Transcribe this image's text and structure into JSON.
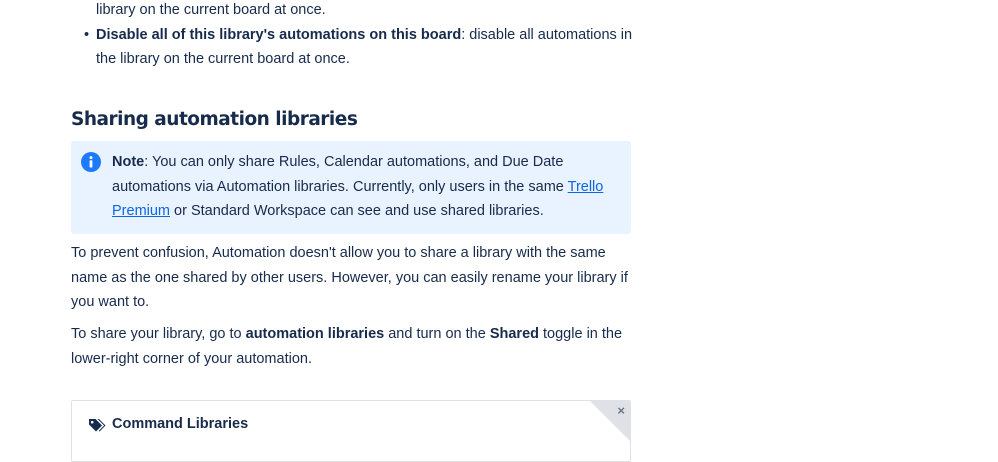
{
  "bullets": [
    {
      "bold": "",
      "text": "library on the current board at once."
    },
    {
      "bold": "Disable all of this library's automations on this board",
      "text": ": disable all automations in the library on the current board at once."
    }
  ],
  "section": {
    "title": "Sharing automation libraries"
  },
  "note": {
    "icon": "info-icon",
    "label": "Note",
    "text_before_link": ": You can only share Rules, Calendar automations, and Due Date automations via Automation libraries. Currently, only users in the same ",
    "link_text": "Trello Premium",
    "text_after_link": " or Standard Workspace can see and use shared libraries."
  },
  "paragraph1": "To prevent confusion, Automation doesn't allow you to share a library with the same name as the one shared by other users. However, you can easily rename your library if you want to.",
  "paragraph2": {
    "part1": "To share your library, go to ",
    "bold1": "automation libraries",
    "part2": " and turn on the ",
    "bold2": "Shared",
    "part3": " toggle in the lower-right corner of your automation."
  },
  "card": {
    "icon": "tags-icon",
    "title": "Command Libraries",
    "close_icon": "close-icon",
    "close_glyph": "×"
  },
  "colors": {
    "text": "#172b4d",
    "link": "#0c66e4",
    "note_bg": "#e9f2ff",
    "info_icon": "#1d7afc"
  }
}
